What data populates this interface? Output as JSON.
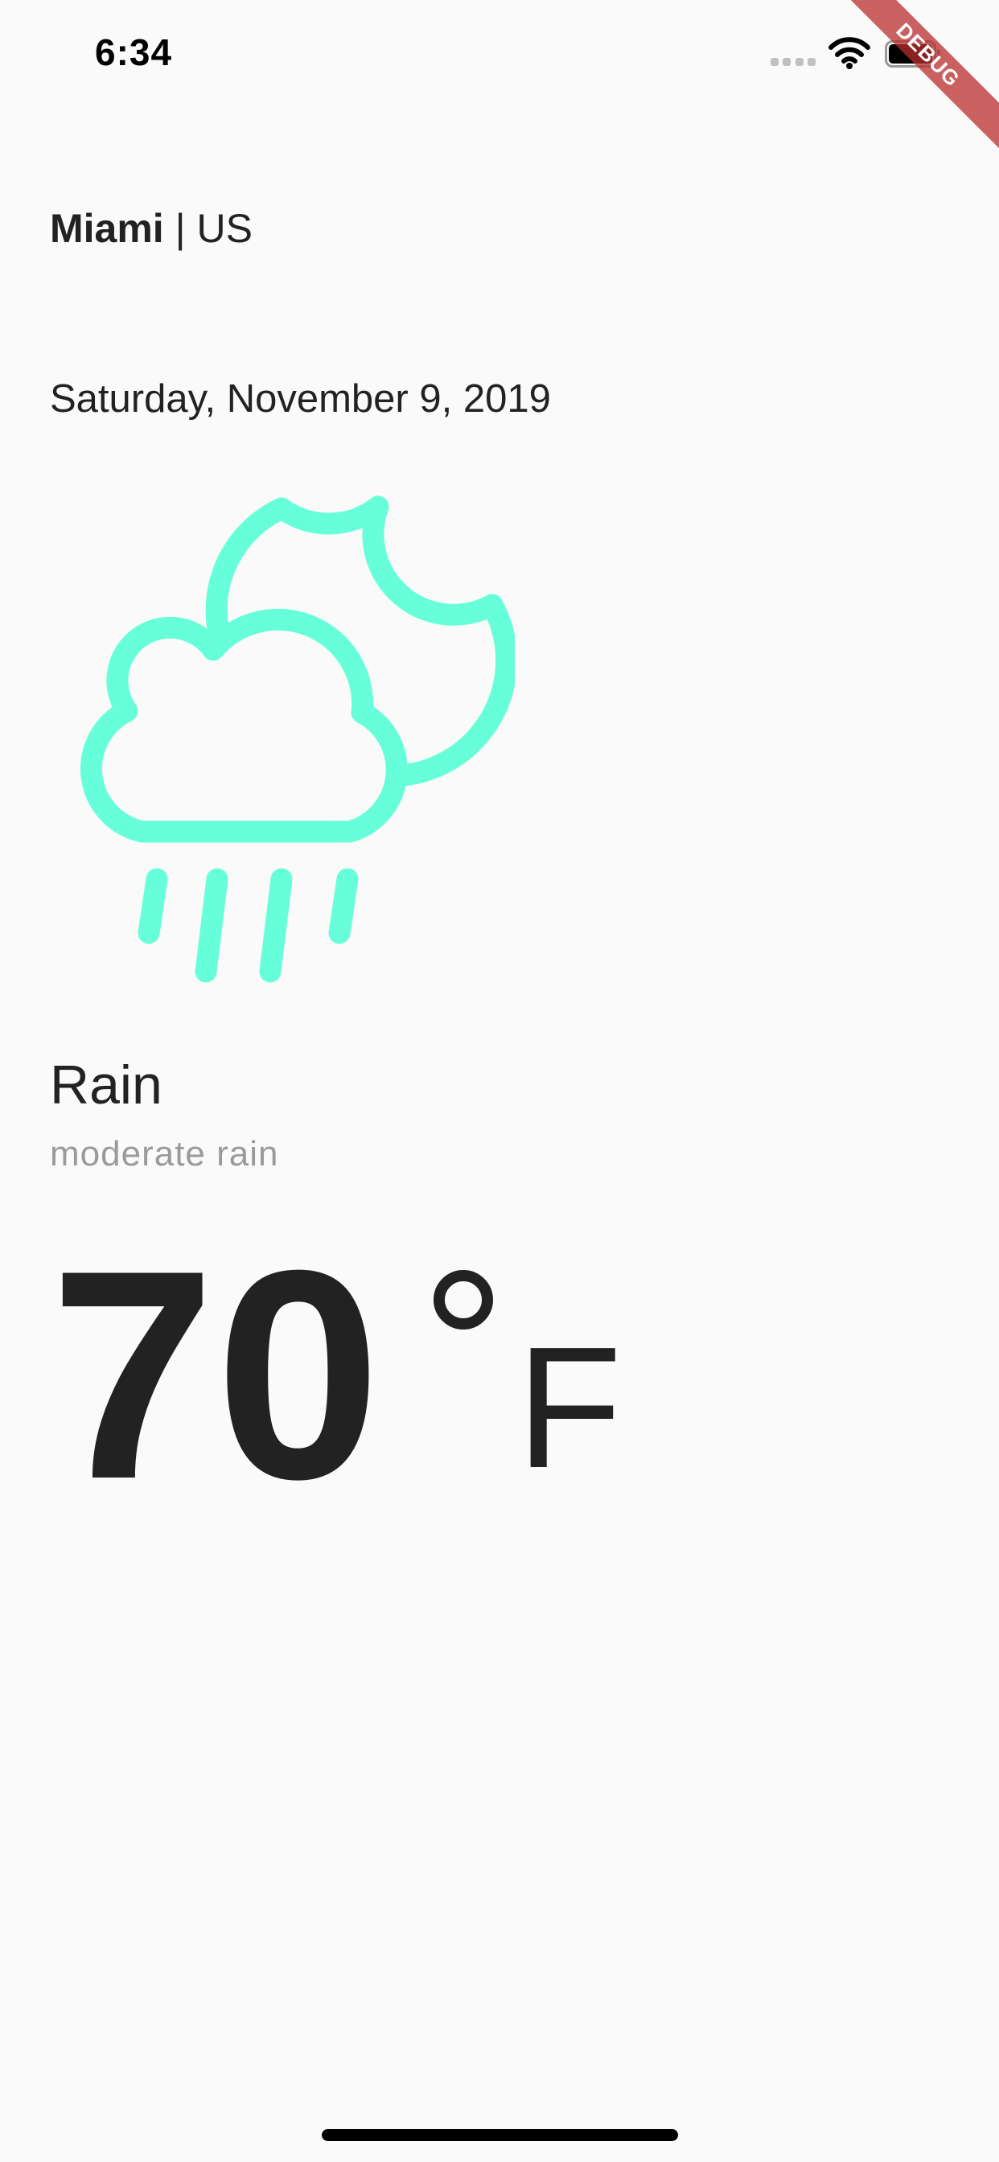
{
  "status_bar": {
    "time": "6:34",
    "icons": [
      "signal-icon",
      "wifi-icon",
      "battery-icon"
    ]
  },
  "debug_banner": {
    "label": "DEBUG"
  },
  "location": {
    "city": "Miami",
    "separator": "|",
    "country": "US"
  },
  "date": "Saturday, November 9, 2019",
  "weather": {
    "icon": "cloud-moon-rain-icon",
    "icon_color": "#66ffd9",
    "condition": "Rain",
    "description": "moderate rain"
  },
  "temperature": {
    "value": "70",
    "unit": "F",
    "degree_icon": "degree-icon"
  },
  "colors": {
    "background": "#fafafa",
    "text": "#222222",
    "muted_text": "#9a9a9a",
    "accent": "#66ffd9"
  }
}
